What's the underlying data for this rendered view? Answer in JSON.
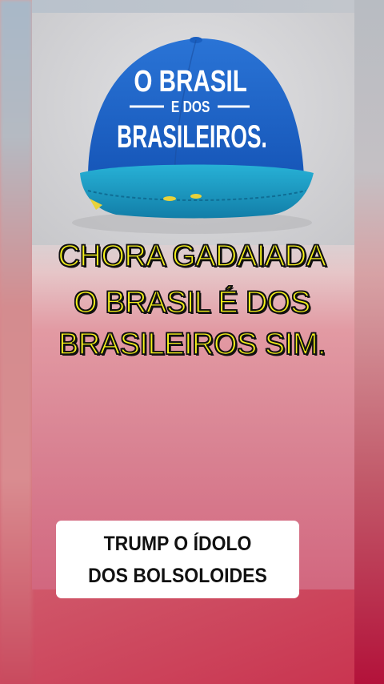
{
  "cap_image": {
    "text_line1": "O BRASIL",
    "text_line2": "E DOS",
    "text_line3": "BRASILEIROS.",
    "cap_color": "#1f63c9",
    "brim_color": "#1e9fc4"
  },
  "overlay": {
    "line1": "CHORA GADAIADA",
    "line2": "O BRASIL É DOS",
    "line3": "BRASILEIROS SIM.",
    "text_color": "#f6f21a"
  },
  "caption_box": {
    "line1": "TRUMP O ÍDOLO",
    "line2": "DOS BOLSOLOIDES"
  }
}
